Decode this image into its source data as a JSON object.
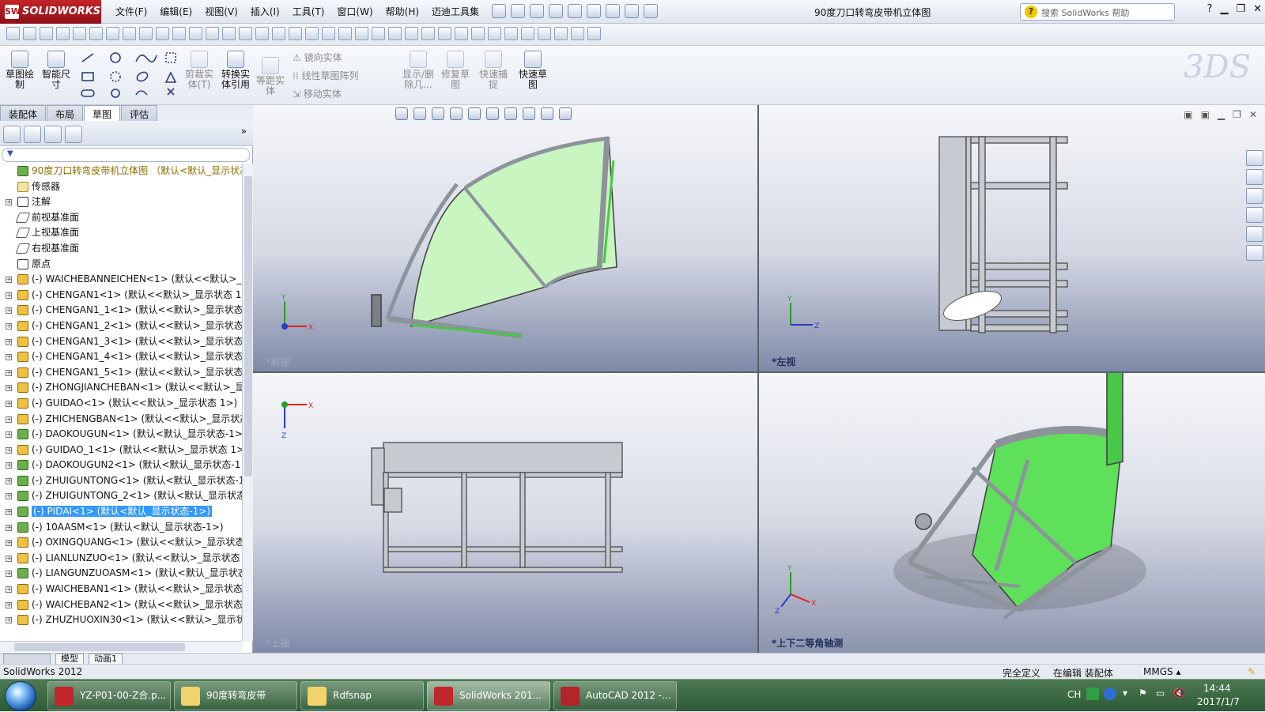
{
  "titlebar": {
    "app_name": "SOLIDWORKS",
    "menus": [
      "文件(F)",
      "编辑(E)",
      "视图(V)",
      "插入(I)",
      "工具(T)",
      "窗口(W)",
      "帮助(H)",
      "迈迪工具集"
    ],
    "document_title": "90度刀口转弯皮带机立体图",
    "help_search_placeholder": "搜索 SolidWorks 帮助"
  },
  "command_manager": {
    "sketch": "草图绘\n制",
    "smart_dim": "智能尺\n寸",
    "trim": "剪裁实\n体(T)",
    "convert": "转换实\n体引用",
    "offset": "等距实\n体",
    "mirror": "镜向实体",
    "linear_pattern": "线性草图阵列",
    "move": "移动实体",
    "show_delete": "显示/删\n除几...",
    "repair": "修复草\n图",
    "quick_snap": "快速捕\n捉",
    "rapid_sketch": "快速草\n图"
  },
  "tabs": [
    "装配体",
    "布局",
    "草图",
    "评估"
  ],
  "active_tab": 2,
  "tree": [
    {
      "label": "90度刀口转弯皮带机立体图 （默认<默认_显示状态",
      "icon": "asm",
      "expand": false,
      "top": true
    },
    {
      "label": "传感器",
      "icon": "folder",
      "expand": false
    },
    {
      "label": "注解",
      "icon": "note",
      "expand": true
    },
    {
      "label": "前视基准面",
      "icon": "plane",
      "expand": false
    },
    {
      "label": "上视基准面",
      "icon": "plane",
      "expand": false
    },
    {
      "label": "右视基准面",
      "icon": "plane",
      "expand": false
    },
    {
      "label": "原点",
      "icon": "origin",
      "expand": false
    },
    {
      "label": "(-) WAICHEBANNEICHEN<1> (默认<<默认>_显",
      "icon": "part",
      "expand": true
    },
    {
      "label": "(-) CHENGAN1<1> (默认<<默认>_显示状态 1>",
      "icon": "part",
      "expand": true
    },
    {
      "label": "(-) CHENGAN1_1<1> (默认<<默认>_显示状态",
      "icon": "part",
      "expand": true
    },
    {
      "label": "(-) CHENGAN1_2<1> (默认<<默认>_显示状态",
      "icon": "part",
      "expand": true
    },
    {
      "label": "(-) CHENGAN1_3<1> (默认<<默认>_显示状态",
      "icon": "part",
      "expand": true
    },
    {
      "label": "(-) CHENGAN1_4<1> (默认<<默认>_显示状态",
      "icon": "part",
      "expand": true
    },
    {
      "label": "(-) CHENGAN1_5<1> (默认<<默认>_显示状态",
      "icon": "part",
      "expand": true
    },
    {
      "label": "(-) ZHONGJIANCHEBAN<1> (默认<<默认>_显",
      "icon": "part",
      "expand": true
    },
    {
      "label": "(-) GUIDAO<1> (默认<<默认>_显示状态 1>)",
      "icon": "part",
      "expand": true
    },
    {
      "label": "(-) ZHICHENGBAN<1> (默认<<默认>_显示状态",
      "icon": "part",
      "expand": true
    },
    {
      "label": "(-) DAOKOUGUN<1> (默认<默认_显示状态-1>",
      "icon": "asm",
      "expand": true
    },
    {
      "label": "(-) GUIDAO_1<1> (默认<<默认>_显示状态 1>)",
      "icon": "part",
      "expand": true
    },
    {
      "label": "(-) DAOKOUGUN2<1> (默认<默认_显示状态-1",
      "icon": "asm",
      "expand": true
    },
    {
      "label": "(-) ZHUIGUNTONG<1> (默认<默认_显示状态-1",
      "icon": "asm",
      "expand": true
    },
    {
      "label": "(-) ZHUIGUNTONG_2<1> (默认<默认_显示状态",
      "icon": "asm",
      "expand": true
    },
    {
      "label": "(-) PIDAI<1> (默认<默认_显示状态-1>)",
      "icon": "asm",
      "expand": true,
      "selected": true
    },
    {
      "label": "(-) 10AASM<1> (默认<默认_显示状态-1>)",
      "icon": "asm",
      "expand": true
    },
    {
      "label": "(-) OXINGQUANG<1> (默认<<默认>_显示状态",
      "icon": "part",
      "expand": true
    },
    {
      "label": "(-) LIANLUNZUO<1> (默认<<默认>_显示状态",
      "icon": "part",
      "expand": true
    },
    {
      "label": "(-) LIANGUNZUOASM<1> (默认<默认_显示状态",
      "icon": "asm",
      "expand": true
    },
    {
      "label": "(-) WAICHEBAN1<1> (默认<<默认>_显示状态",
      "icon": "part",
      "expand": true
    },
    {
      "label": "(-) WAICHEBAN2<1> (默认<<默认>_显示状态",
      "icon": "part",
      "expand": true
    },
    {
      "label": "(-) ZHUZHUOXIN30<1> (默认<<默认>_显示状",
      "icon": "part",
      "expand": true
    }
  ],
  "viewports": {
    "top_left": "*前视",
    "top_right": "*左视",
    "bottom_left": "*上视",
    "bottom_right": "*上下二等角轴测"
  },
  "axis_labels": {
    "x": "X",
    "y": "Y",
    "z": "Z"
  },
  "model_tabs": [
    "模型",
    "动画1"
  ],
  "status": {
    "app": "SolidWorks 2012",
    "defined": "完全定义",
    "editing": "在编辑 装配体",
    "units": "MMGS ▴"
  },
  "taskbar": {
    "items": [
      {
        "label": "YZ-P01-00-Z合.p...",
        "color": "#c0262b"
      },
      {
        "label": "90度转弯皮带",
        "color": "#f2d36b"
      },
      {
        "label": "Rdfsnap",
        "color": "#f2d36b"
      },
      {
        "label": "SolidWorks 201...",
        "color": "#c0262b",
        "active": true
      },
      {
        "label": "AutoCAD 2012 -...",
        "color": "#b3252a"
      }
    ],
    "lang": "CH",
    "time": "14:44",
    "date": "2017/1/7"
  },
  "colors": {
    "accent_green": "#5ee05a",
    "belt_light": "#c9f5c0",
    "frame_gray": "#9aa0a8"
  }
}
